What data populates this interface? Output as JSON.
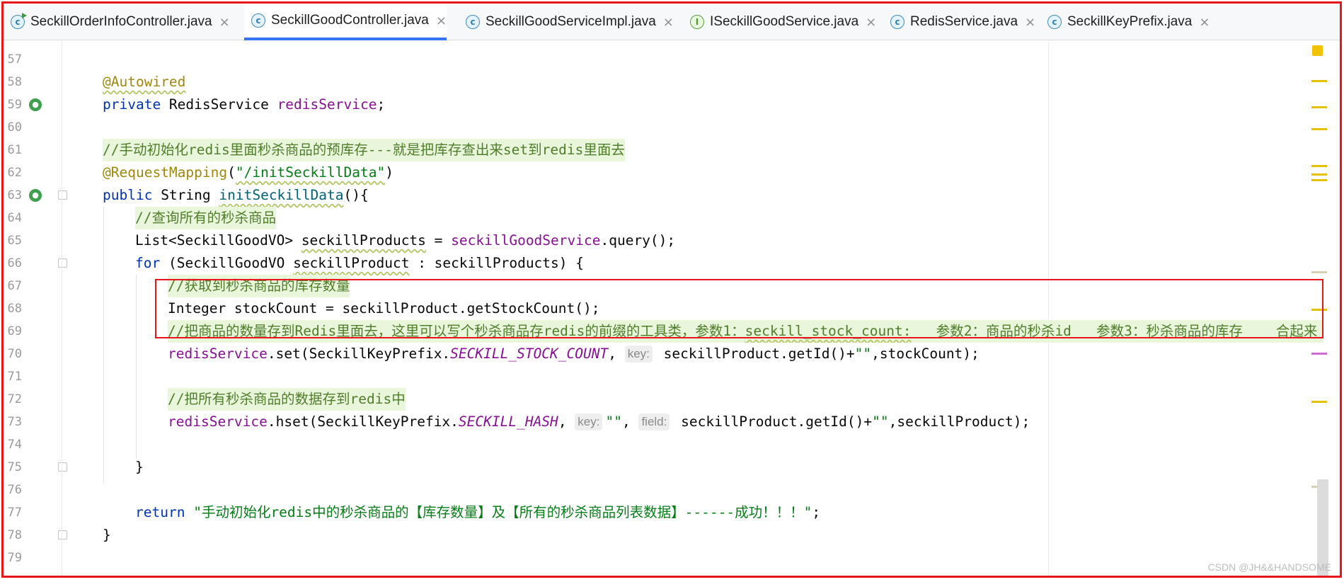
{
  "colors": {
    "frame": "#e8161b",
    "active_tab_underline": "#3574f0",
    "keyword": "#0033b3",
    "annotation": "#9e880d",
    "field": "#871094",
    "string": "#067d17",
    "comment": "#4f7d2a"
  },
  "tabs": [
    {
      "label": "SeckillOrderInfoController.java",
      "icon": "class-runnable-icon",
      "active": false
    },
    {
      "label": "SeckillGoodController.java",
      "icon": "class-icon",
      "active": true
    },
    {
      "label": "SeckillGoodServiceImpl.java",
      "icon": "class-icon",
      "active": false
    },
    {
      "label": "ISeckillGoodService.java",
      "icon": "interface-icon",
      "active": false
    },
    {
      "label": "RedisService.java",
      "icon": "class-icon",
      "active": false
    },
    {
      "label": "SeckillKeyPrefix.java",
      "icon": "class-icon",
      "active": false
    }
  ],
  "gutter": {
    "line_numbers": [
      "57",
      "58",
      "59",
      "60",
      "61",
      "62",
      "63",
      "64",
      "65",
      "66",
      "67",
      "68",
      "69",
      "70",
      "71",
      "72",
      "73",
      "74",
      "75",
      "76",
      "77",
      "78",
      "79"
    ]
  },
  "code": {
    "l58": "@Autowired",
    "l59_kw": "private",
    "l59_type": " RedisService ",
    "l59_field": "redisService",
    "l59_end": ";",
    "l61_comment_a": "//手动初始化",
    "l61_comment_b": "redis",
    "l61_comment_c": "里面秒杀商品的预库存---就是把库存查出来",
    "l61_comment_d": "set",
    "l61_comment_e": "到",
    "l61_comment_f": "redis",
    "l61_comment_g": "里面去",
    "l62_ann": "@RequestMapping",
    "l62_open": "(",
    "l62_str": "\"/initSeckillData\"",
    "l62_close": ")",
    "l63_kw": "public",
    "l63_type": " String ",
    "l63_method": "initSeckillData",
    "l63_end": "(){",
    "l64_comment": "//查询所有的秒杀商品",
    "l65_a": "List<SeckillGoodVO> ",
    "l65_b": "seckillProducts",
    "l65_c": " = ",
    "l65_field": "seckillGoodService",
    "l65_d": ".query();",
    "l66_kw": "for",
    "l66_a": " (SeckillGoodVO ",
    "l66_b": "seckillProduct",
    "l66_c": " : seckillProducts) {",
    "l67_comment": "//获取到秒杀商品的库存数量",
    "l68": "Integer stockCount = seckillProduct.getStockCount();",
    "l69_comment_a": "//把商品的数量存到",
    "l69_comment_b": "Redis",
    "l69_comment_c": "里面去，这里可以写个秒杀商品存",
    "l69_comment_d": "redis",
    "l69_comment_e": "的前缀的工具类，参数1：",
    "l69_comment_f": "seckill_stock_count:",
    "l69_comment_g": "   参数2：商品的秒杀",
    "l69_comment_h": "id",
    "l69_comment_i": "   参数3：秒杀商品的库存    合起来",
    "l70_field": "redisService",
    "l70_a": ".set(SeckillKeyPrefix.",
    "l70_const": "SECKILL_STOCK_COUNT",
    "l70_b": ", ",
    "l70_hint": "key:",
    "l70_c": " seckillProduct.getId()+",
    "l70_str": "\"\"",
    "l70_d": ",stockCount);",
    "l72_comment_a": "//把所有秒杀商品的数据存到",
    "l72_comment_b": "redis",
    "l72_comment_c": "中",
    "l73_field": "redisService",
    "l73_a": ".hset(SeckillKeyPrefix.",
    "l73_const": "SECKILL_HASH",
    "l73_b": ", ",
    "l73_hint1": "key:",
    "l73_str1": "\"\"",
    "l73_c": ", ",
    "l73_hint2": "field:",
    "l73_d": " seckillProduct.getId()+",
    "l73_str2": "\"\"",
    "l73_e": ",seckillProduct);",
    "l75": "}",
    "l77_kw": "return",
    "l77_sp": " ",
    "l77_str": "\"手动初始化redis中的秒杀商品的【库存数量】及【所有的秒杀商品列表数据】------成功！！！\"",
    "l77_end": ";",
    "l78": "}"
  },
  "watermark": "CSDN @JH&&HANDSOME"
}
